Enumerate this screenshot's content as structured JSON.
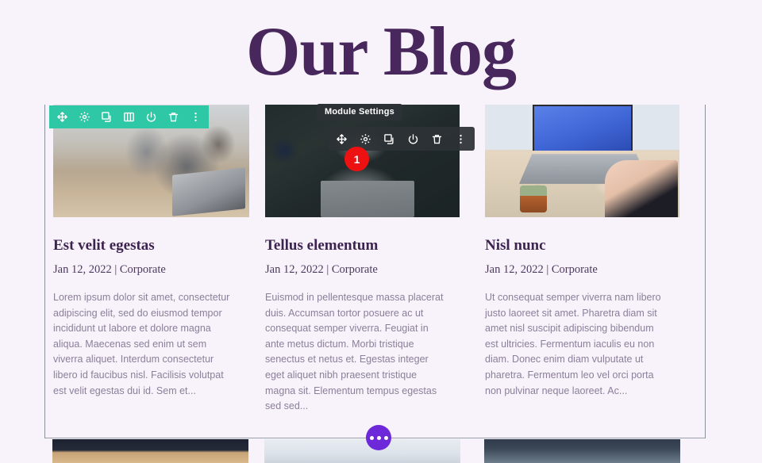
{
  "page": {
    "heading": "Our Blog",
    "background_color": "#f8f2fb",
    "heading_color": "#48285c"
  },
  "section_toolbar": {
    "name": "section-settings-toolbar",
    "background_color": "#2ec8a6",
    "icons": [
      "move-icon",
      "gear-icon",
      "duplicate-icon",
      "columns-icon",
      "power-icon",
      "trash-icon",
      "more-options-icon"
    ]
  },
  "module_toolbar": {
    "tooltip": "Module Settings",
    "background_color": "#2c3136",
    "badge_count": "1",
    "badge_color": "#ee1111",
    "icons": [
      "move-icon",
      "gear-icon",
      "duplicate-icon",
      "power-icon",
      "trash-icon",
      "more-options-icon"
    ]
  },
  "fab": {
    "label": "page-settings-button",
    "color": "#6d28d9",
    "icon": "ellipsis-icon"
  },
  "posts": [
    {
      "title": "Est velit egestas",
      "meta": "Jan 12, 2022 | Corporate",
      "excerpt": "Lorem ipsum dolor sit amet, consectetur adipiscing elit, sed do eiusmod tempor incididunt ut labore et dolore magna aliqua. Maecenas sed enim ut sem viverra aliquet. Interdum consectetur libero id faucibus nisl. Facilisis volutpat est velit egestas dui id. Sem et...",
      "image": "man-with-glasses-at-laptop-in-cafe"
    },
    {
      "title": "Tellus elementum",
      "meta": "Jan 12, 2022 | Corporate",
      "excerpt": "Euismod in pellentesque massa placerat duis. Accumsan tortor posuere ac ut consequat semper viverra. Feugiat in ante metus dictum. Morbi tristique senectus et netus et. Egestas integer eget aliquet nibh praesent tristique magna sit. Elementum tempus egestas sed sed...",
      "image": "dark-desk-with-laptop-notebook-and-mug"
    },
    {
      "title": "Nisl nunc",
      "meta": "Jan 12, 2022 | Corporate",
      "excerpt": "Ut consequat semper viverra nam libero justo laoreet sit amet. Pharetra diam sit amet nisl suscipit adipiscing bibendum est ultricies. Fermentum iaculis eu non diam. Donec enim diam vulputate ut pharetra. Fermentum leo vel orci porta non pulvinar neque laoreet. Ac...",
      "image": "hands-typing-on-macbook-with-plant"
    }
  ],
  "lower_row": {
    "images": [
      "dark-suit-at-wooden-table",
      "light-desk-with-documents",
      "office-meeting-scene"
    ]
  }
}
